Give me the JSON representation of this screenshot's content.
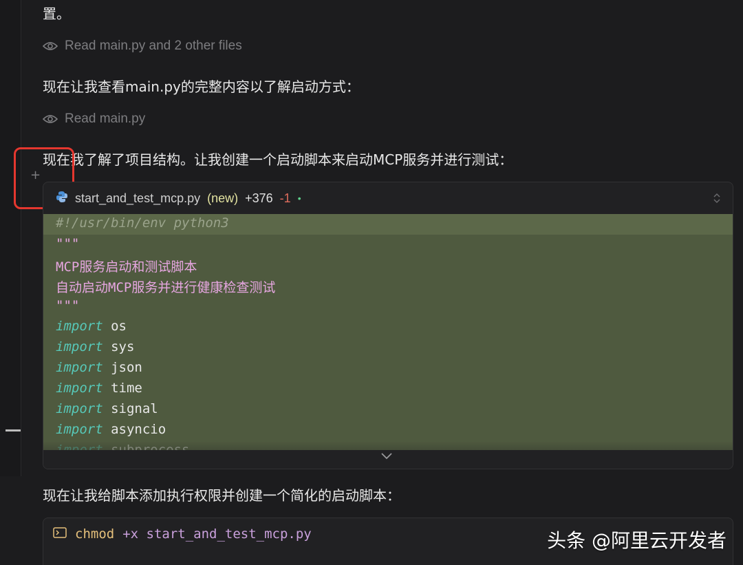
{
  "messages": {
    "m0": "置。",
    "read1": "Read main.py and 2 other files",
    "m1": "现在让我查看main.py的完整内容以了解启动方式：",
    "read2": "Read main.py",
    "m2": "现在我了解了项目结构。让我创建一个启动脚本来启动MCP服务并进行测试：",
    "m3": "现在让我给脚本添加执行权限并创建一个简化的启动脚本："
  },
  "file_card": {
    "filename": "start_and_test_mcp.py",
    "status": "(new)",
    "added": "+376",
    "removed": "-1",
    "dot": "•"
  },
  "code": {
    "shebang": "#!/usr/bin/env python3",
    "docquote_open": "\"\"\"",
    "doc1": "MCP服务启动和测试脚本",
    "doc2": "自动启动MCP服务并进行健康检查测试",
    "docquote_close": "\"\"\"",
    "keyword": "import",
    "modules": [
      "os",
      "sys",
      "json",
      "time",
      "signal",
      "asyncio",
      "subprocess"
    ]
  },
  "terminal": {
    "command": "chmod",
    "args": "+x start_and_test_mcp.py"
  },
  "watermark": "头条 @阿里云开发者",
  "colors": {
    "background": "#1c1c1e",
    "code_added_bg": "#4f5a3f",
    "keyword": "#57c9b9",
    "string": "#e6a6e0",
    "highlight_box": "#e5372f"
  }
}
